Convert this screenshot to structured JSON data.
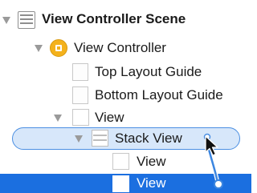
{
  "outline": {
    "scene": {
      "label": "View Controller Scene",
      "icon": "storyboard-scene-icon"
    },
    "view_controller": {
      "label": "View Controller",
      "icon": "view-controller-icon"
    },
    "top_layout_guide": {
      "label": "Top Layout Guide",
      "icon": "layout-guide-icon"
    },
    "bottom_layout_guide": {
      "label": "Bottom Layout Guide",
      "icon": "layout-guide-icon"
    },
    "view": {
      "label": "View",
      "icon": "view-icon"
    },
    "stack_view": {
      "label": "Stack View",
      "icon": "stack-view-icon"
    },
    "child_view_1": {
      "label": "View",
      "icon": "view-icon"
    },
    "child_view_2": {
      "label": "View",
      "icon": "view-icon",
      "selected": true
    }
  },
  "colors": {
    "selection": "#1b6fe0",
    "drop_highlight_fill": "#d7e7fa",
    "drop_highlight_border": "#4b8fe2",
    "view_controller_icon": "#f4b21c"
  }
}
